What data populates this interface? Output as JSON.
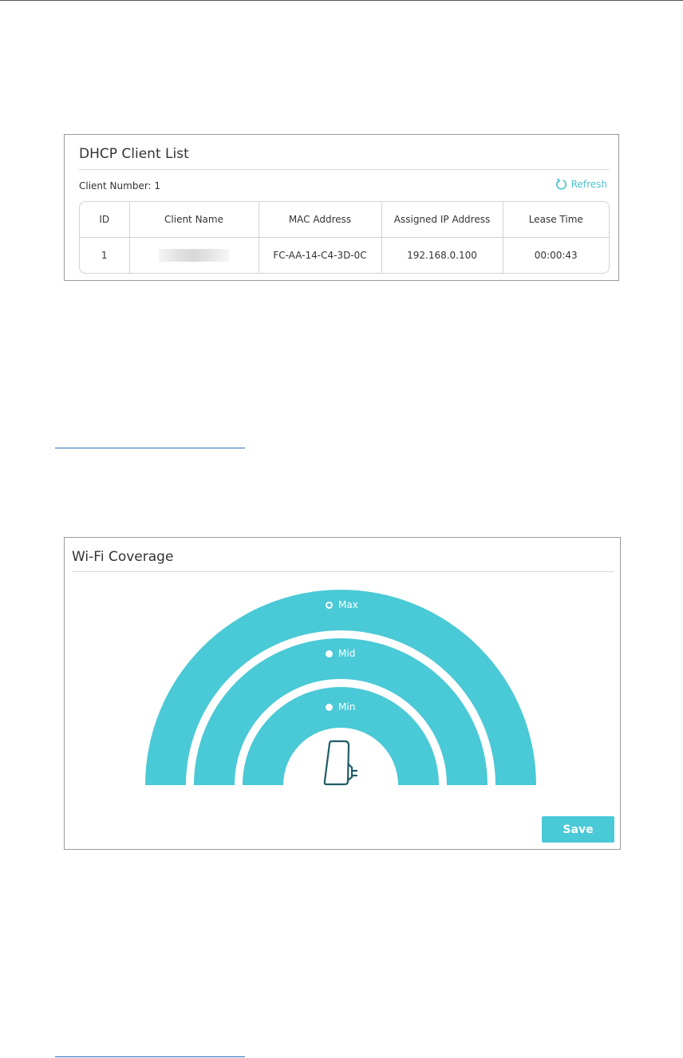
{
  "dhcp": {
    "title": "DHCP Client List",
    "client_number_label": "Client Number: 1",
    "refresh_label": "Refresh",
    "columns": [
      "ID",
      "Client Name",
      "MAC Address",
      "Assigned IP Address",
      "Lease Time"
    ],
    "rows": [
      {
        "id": "1",
        "client_name": "",
        "mac": "FC-AA-14-C4-3D-0C",
        "ip": "192.168.0.100",
        "lease": "00:00:43"
      }
    ]
  },
  "wifi": {
    "title": "Wi-Fi Coverage",
    "options": [
      {
        "label": "Max",
        "selected": true
      },
      {
        "label": "Mid",
        "selected": false
      },
      {
        "label": "Min",
        "selected": false
      }
    ],
    "save_label": "Save"
  },
  "colors": {
    "accent": "#4ac9d6",
    "arc": "#4ac9d6",
    "device_outline": "#1f5c66",
    "link_line": "#2a6fb8"
  },
  "icons": {
    "refresh": "refresh-icon",
    "device": "extender-device-icon"
  }
}
